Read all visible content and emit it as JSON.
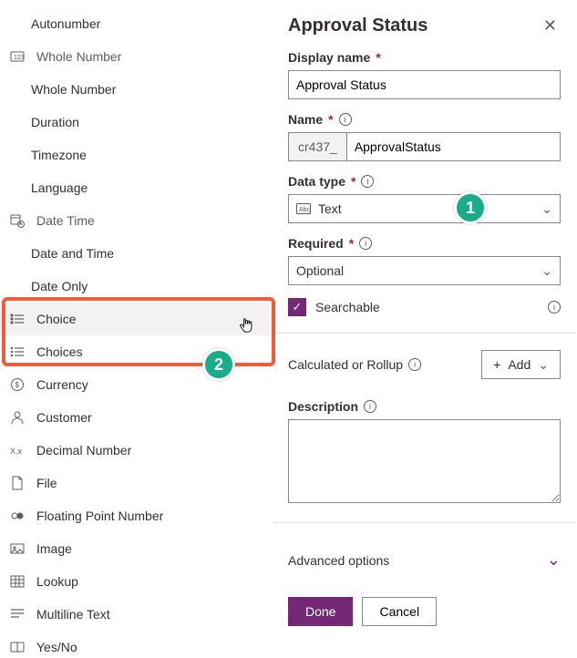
{
  "types": {
    "autonumber": "Autonumber",
    "whole_number_header": "Whole Number",
    "whole_number": "Whole Number",
    "duration": "Duration",
    "timezone": "Timezone",
    "language": "Language",
    "date_time_header": "Date Time",
    "date_and_time": "Date and Time",
    "date_only": "Date Only",
    "choice": "Choice",
    "choices": "Choices",
    "currency": "Currency",
    "customer": "Customer",
    "decimal_number": "Decimal Number",
    "file": "File",
    "floating_point": "Floating Point Number",
    "image": "Image",
    "lookup": "Lookup",
    "multiline_text": "Multiline Text",
    "yes_no": "Yes/No"
  },
  "panel": {
    "title": "Approval Status",
    "labels": {
      "display_name": "Display name",
      "name": "Name",
      "data_type": "Data type",
      "required": "Required",
      "searchable": "Searchable",
      "calc_rollup": "Calculated or Rollup",
      "add": "Add",
      "description": "Description",
      "advanced": "Advanced options",
      "done": "Done",
      "cancel": "Cancel"
    },
    "values": {
      "display_name": "Approval Status",
      "name_prefix": "cr437_",
      "name": "ApprovalStatus",
      "data_type": "Text",
      "required": "Optional",
      "searchable_checked": true
    }
  },
  "annotations": {
    "badge1": "1",
    "badge2": "2"
  }
}
